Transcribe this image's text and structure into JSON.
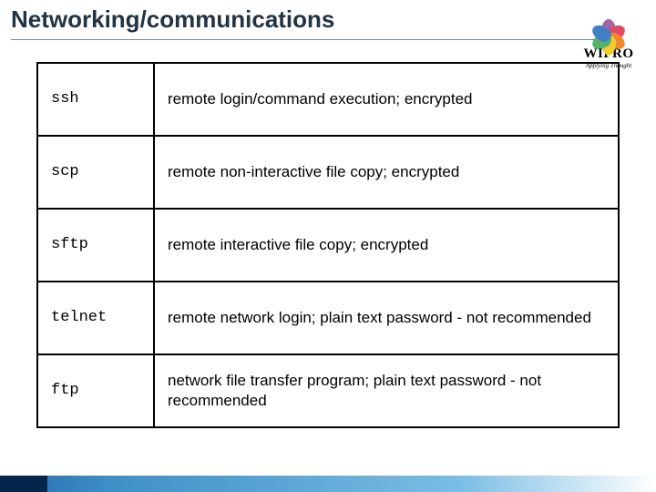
{
  "slide": {
    "title": "Networking/communications"
  },
  "logo": {
    "wordmark": "WIPRO",
    "tagline": "Applying Thought"
  },
  "table": {
    "rows": [
      {
        "command": "ssh",
        "description": "remote login/command execution; encrypted"
      },
      {
        "command": "scp",
        "description": "remote non-interactive file copy; encrypted"
      },
      {
        "command": "sftp",
        "description": "remote interactive file copy; encrypted"
      },
      {
        "command": "telnet",
        "description": "remote network login; plain text password - not recommended"
      },
      {
        "command": "ftp",
        "description": "network file transfer program; plain text password - not recommended"
      }
    ]
  }
}
